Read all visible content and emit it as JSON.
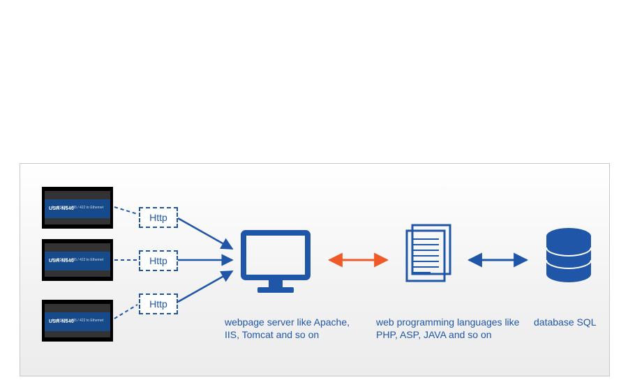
{
  "device_label": "USR-N540",
  "device_sub": "4 x RS232 / 485 / 422 to Ethernet",
  "protocol_label": "Http",
  "captions": {
    "server": "webpage server like Apache, IIS, Tomcat and so on",
    "lang": "web programming languages like PHP, ASP, JAVA and so on",
    "db": "database SQL"
  },
  "colors": {
    "accent_blue": "#1f56a8",
    "accent_orange": "#ef5a28",
    "device_body": "#174a8a"
  },
  "chart_data": {
    "type": "table",
    "diagram_flow": [
      {
        "node": "USR-N540 device",
        "count": 3,
        "edge_label": "Http",
        "edge_to": "webpage server"
      },
      {
        "node": "webpage server like Apache, IIS, Tomcat and so on",
        "edge_label": "bidirectional",
        "edge_to": "web programming languages"
      },
      {
        "node": "web programming languages like PHP, ASP, JAVA and so on",
        "edge_label": "bidirectional",
        "edge_to": "database SQL"
      },
      {
        "node": "database SQL"
      }
    ]
  }
}
